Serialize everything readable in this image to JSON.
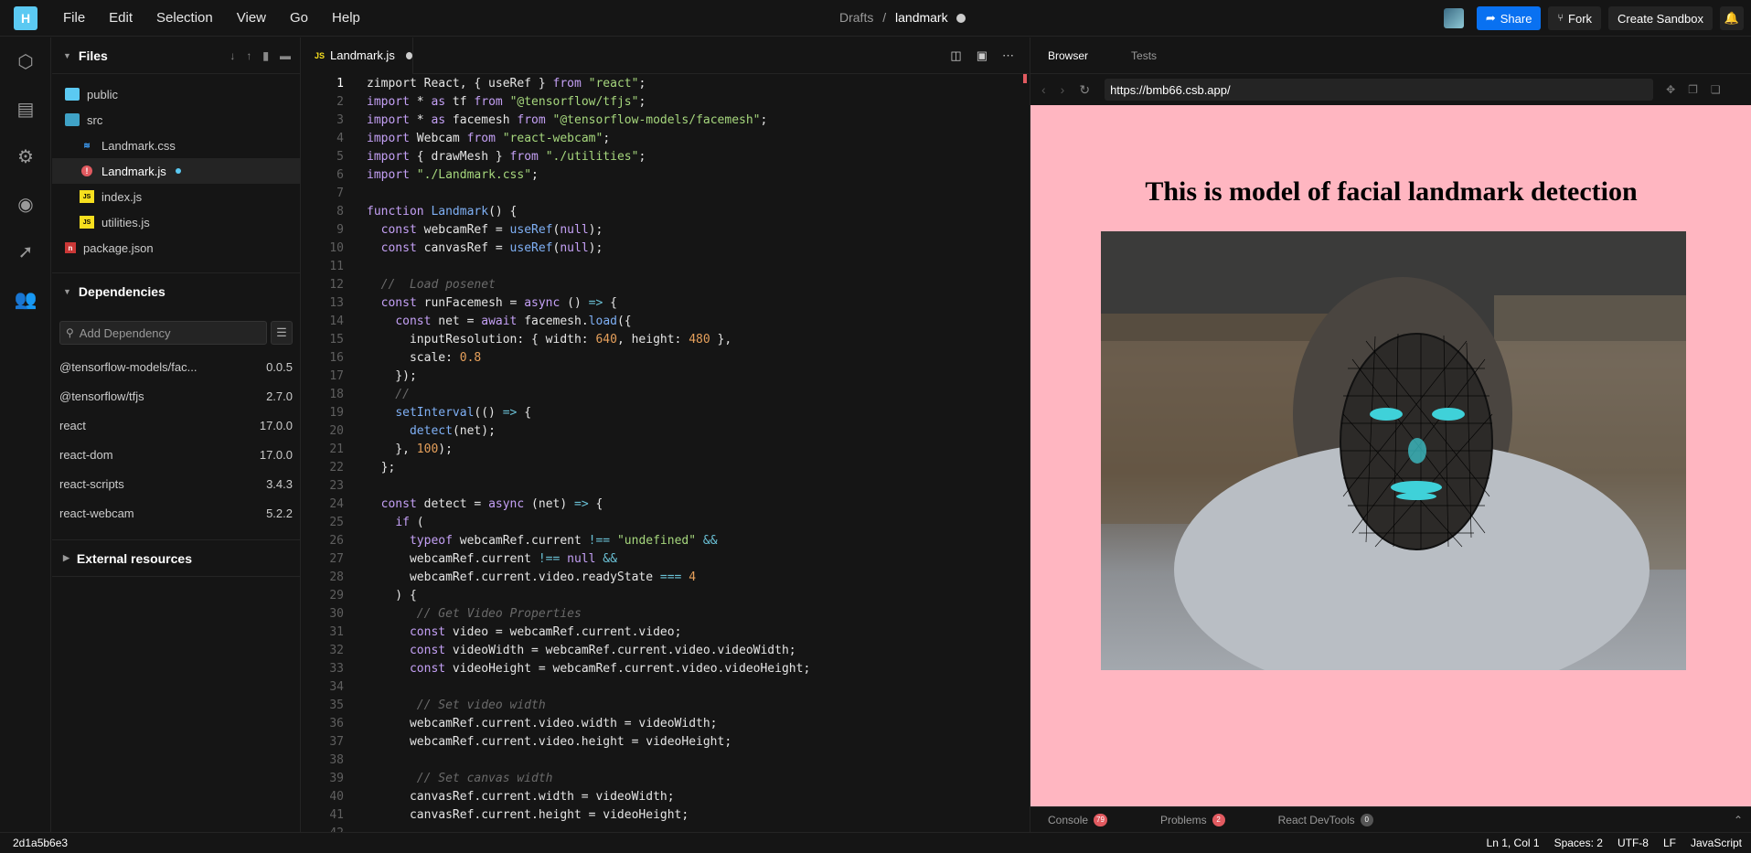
{
  "app": {
    "logo": "H",
    "crumb_parent": "Drafts",
    "crumb_sep": "/",
    "crumb_title": "landmark"
  },
  "menu": [
    "File",
    "Edit",
    "Selection",
    "View",
    "Go",
    "Help"
  ],
  "header_buttons": {
    "share": "Share",
    "fork": "Fork",
    "create": "Create Sandbox"
  },
  "activity_icons": [
    "cube-icon",
    "file-icon",
    "gear-icon",
    "github-icon",
    "rocket-icon",
    "users-icon"
  ],
  "files": {
    "title": "Files",
    "items": [
      {
        "name": "public",
        "type": "folder"
      },
      {
        "name": "src",
        "type": "folder-open"
      },
      {
        "name": "Landmark.css",
        "type": "css"
      },
      {
        "name": "Landmark.js",
        "type": "error"
      },
      {
        "name": "index.js",
        "type": "js"
      },
      {
        "name": "utilities.js",
        "type": "js"
      },
      {
        "name": "package.json",
        "type": "npm"
      }
    ]
  },
  "deps": {
    "title": "Dependencies",
    "placeholder": "Add Dependency",
    "items": [
      {
        "name": "@tensorflow-models/fac...",
        "version": "0.0.5"
      },
      {
        "name": "@tensorflow/tfjs",
        "version": "2.7.0"
      },
      {
        "name": "react",
        "version": "17.0.0"
      },
      {
        "name": "react-dom",
        "version": "17.0.0"
      },
      {
        "name": "react-scripts",
        "version": "3.4.3"
      },
      {
        "name": "react-webcam",
        "version": "5.2.2"
      }
    ]
  },
  "external": {
    "title": "External resources"
  },
  "editor": {
    "tab": "Landmark.js",
    "tab_badge": "JS"
  },
  "code": [
    "zimport React, { useRef } from \"react\";",
    "import * as tf from \"@tensorflow/tfjs\";",
    "import * as facemesh from \"@tensorflow-models/facemesh\";",
    "import Webcam from \"react-webcam\";",
    "import { drawMesh } from \"./utilities\";",
    "import \"./Landmark.css\";",
    "",
    "function Landmark() {",
    "  const webcamRef = useRef(null);",
    "  const canvasRef = useRef(null);",
    "",
    "  //  Load posenet",
    "  const runFacemesh = async () => {",
    "    const net = await facemesh.load({",
    "      inputResolution: { width: 640, height: 480 },",
    "      scale: 0.8",
    "    });",
    "    //",
    "    setInterval(() => {",
    "      detect(net);",
    "    }, 100);",
    "  };",
    "",
    "  const detect = async (net) => {",
    "    if (",
    "      typeof webcamRef.current !== \"undefined\" &&",
    "      webcamRef.current !== null &&",
    "      webcamRef.current.video.readyState === 4",
    "    ) {",
    "       // Get Video Properties",
    "      const video = webcamRef.current.video;",
    "      const videoWidth = webcamRef.current.video.videoWidth;",
    "      const videoHeight = webcamRef.current.video.videoHeight;",
    "",
    "       // Set video width",
    "      webcamRef.current.video.width = videoWidth;",
    "      webcamRef.current.video.height = videoHeight;",
    "",
    "       // Set canvas width",
    "      canvasRef.current.width = videoWidth;",
    "      canvasRef.current.height = videoHeight;",
    ""
  ],
  "preview": {
    "tabs": [
      "Browser",
      "Tests"
    ],
    "url": "https://bmb66.csb.app/",
    "heading": "This is model of facial landmark detection"
  },
  "console": [
    {
      "label": "Console",
      "count": "79"
    },
    {
      "label": "Problems",
      "count": "2"
    },
    {
      "label": "React DevTools",
      "count": "0"
    }
  ],
  "status": {
    "hash": "2d1a5b6e3",
    "pos": "Ln 1, Col 1",
    "spaces": "Spaces: 2",
    "enc": "UTF-8",
    "eol": "LF",
    "lang": "JavaScript"
  }
}
